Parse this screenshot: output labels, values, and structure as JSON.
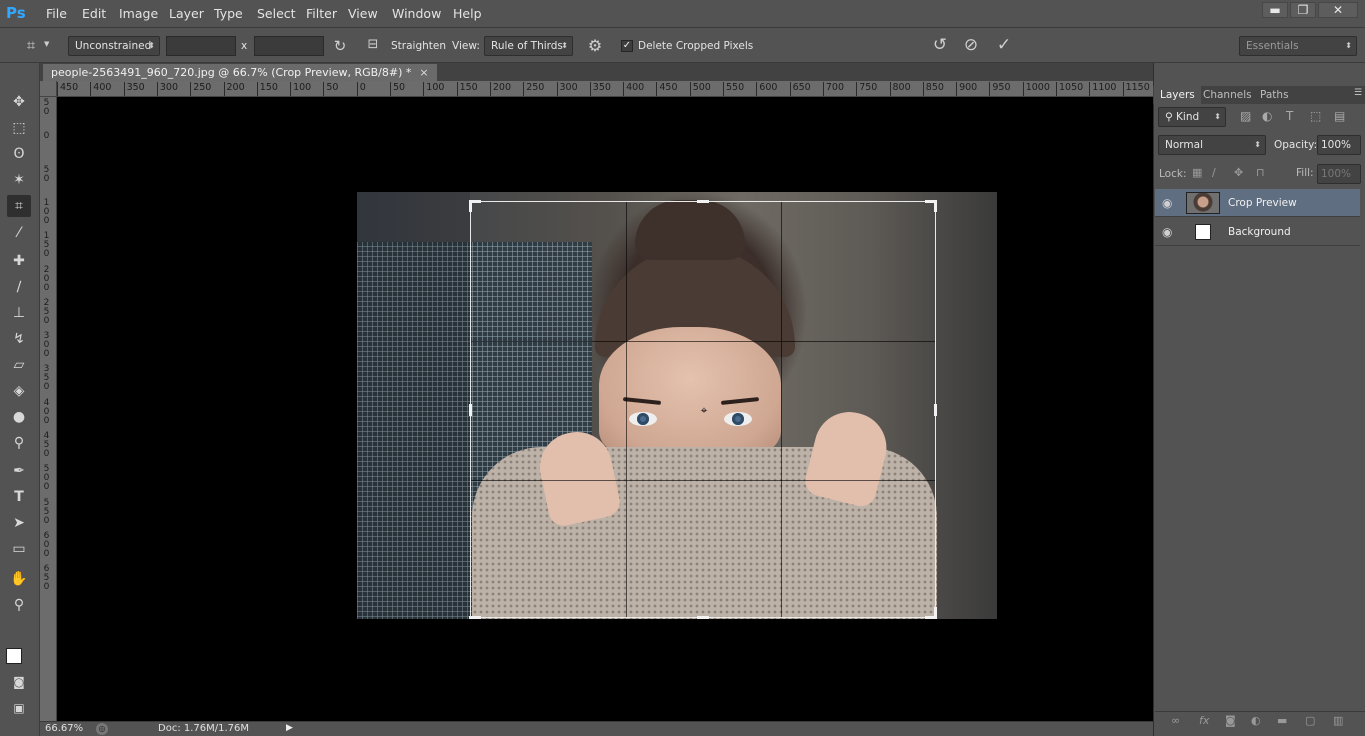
{
  "app": {
    "logo": "Ps"
  },
  "menu": [
    "File",
    "Edit",
    "Image",
    "Layer",
    "Type",
    "Select",
    "Filter",
    "View",
    "Window",
    "Help"
  ],
  "window_controls": {
    "minimize": "▬",
    "restore": "❐",
    "close": "✕"
  },
  "options": {
    "ratio": "Unconstrained",
    "x_separator": "x",
    "straighten": "Straighten",
    "view_label": "View:",
    "view_value": "Rule of Thirds",
    "delete_cropped": "Delete Cropped Pixels",
    "delete_cropped_checked": true,
    "workspace": "Essentials"
  },
  "document": {
    "tab_title": "people-2563491_960_720.jpg @ 66.7% (Crop Preview, RGB/8#) *",
    "close": "×"
  },
  "ruler": {
    "horizontal": [
      "450",
      "400",
      "350",
      "300",
      "250",
      "200",
      "150",
      "100",
      "50",
      "0",
      "50",
      "100",
      "150",
      "200",
      "250",
      "300",
      "350",
      "400",
      "450",
      "500",
      "550",
      "600",
      "650",
      "700",
      "750",
      "800",
      "850",
      "900",
      "950",
      "1000",
      "1050",
      "1100",
      "1150"
    ],
    "vertical": [
      "50",
      "0",
      "50",
      "100",
      "150",
      "200",
      "250",
      "300",
      "350",
      "400",
      "450",
      "500",
      "550",
      "600",
      "650"
    ]
  },
  "status": {
    "zoom": "66.67%",
    "doc": "Doc: 1.76M/1.76M"
  },
  "panel": {
    "tabs": [
      "Layers",
      "Channels",
      "Paths"
    ],
    "kind": "Kind",
    "blend_mode": "Normal",
    "opacity_label": "Opacity:",
    "opacity_value": "100%",
    "lock_label": "Lock:",
    "fill_label": "Fill:",
    "fill_value": "100%",
    "layers": [
      {
        "name": "Crop Preview",
        "selected": true
      },
      {
        "name": "Background",
        "selected": false
      }
    ]
  },
  "colors": {
    "chrome": "#535353",
    "canvas": "#000000",
    "selected_layer": "#5f6e80",
    "ps_blue": "#31a8ff"
  },
  "icons": {
    "toolbox": [
      "move-icon",
      "marquee-icon",
      "lasso-icon",
      "magic-wand-icon",
      "crop-icon",
      "eyedropper-icon",
      "healing-brush-icon",
      "brush-icon",
      "clone-stamp-icon",
      "history-brush-icon",
      "eraser-icon",
      "paint-bucket-icon",
      "blur-icon",
      "dodge-icon",
      "pen-icon",
      "type-icon",
      "path-select-icon",
      "rectangle-icon",
      "hand-icon",
      "zoom-icon"
    ]
  }
}
